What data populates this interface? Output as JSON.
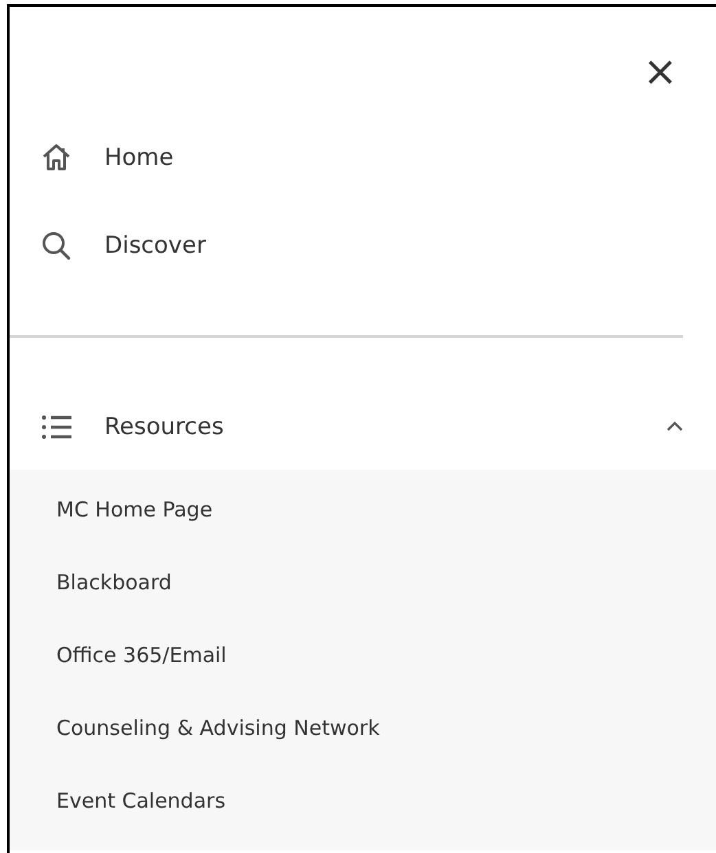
{
  "close_button": {
    "label": "×"
  },
  "nav_items": [
    {
      "kind": "home",
      "label": "Home"
    },
    {
      "kind": "search",
      "label": "Discover"
    }
  ],
  "section": {
    "kind": "list",
    "label": "Resources",
    "expanded": true,
    "items": [
      {
        "label": "MC Home Page"
      },
      {
        "label": "Blackboard"
      },
      {
        "label": "Office 365/Email"
      },
      {
        "label": "Counseling & Advising Network"
      },
      {
        "label": "Event Calendars"
      }
    ]
  }
}
